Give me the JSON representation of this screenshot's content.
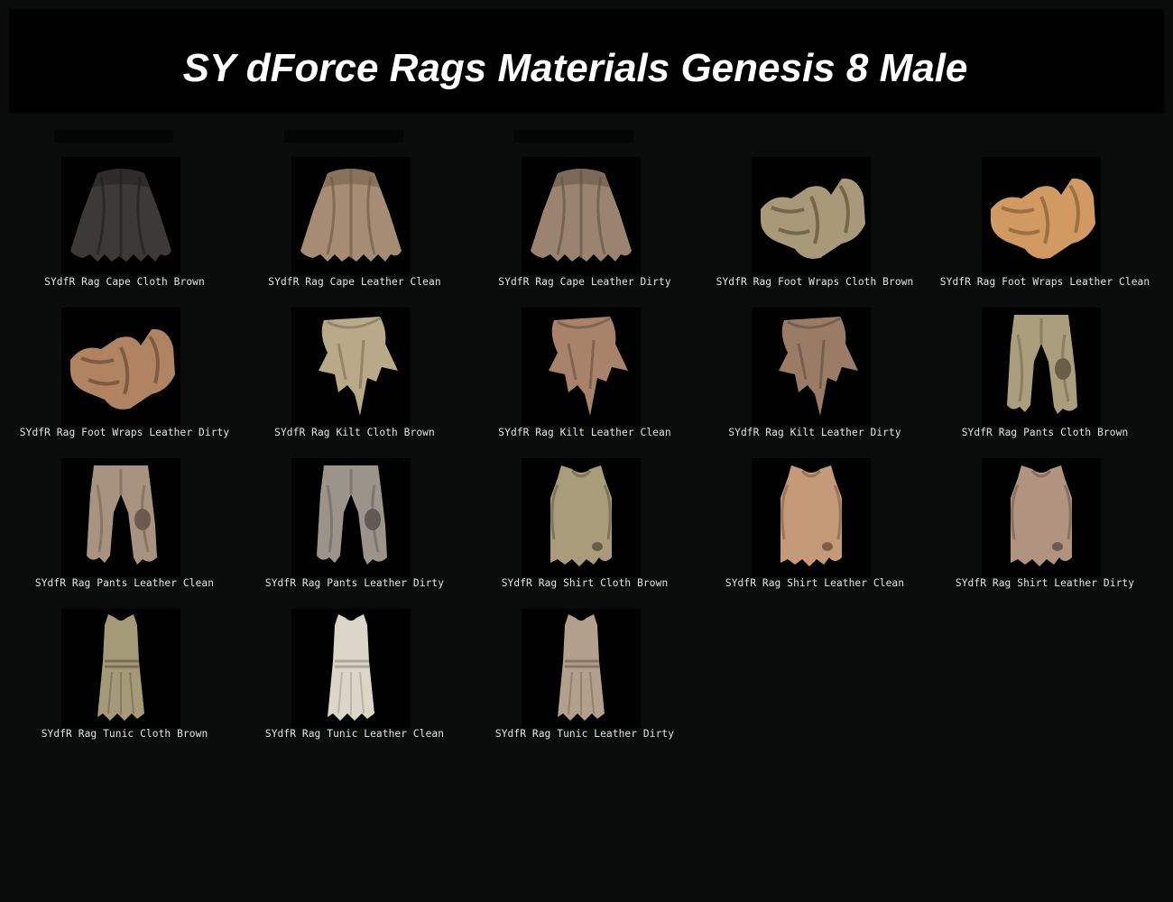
{
  "page": {
    "title": "SY dForce Rags Materials Genesis 8 Male"
  },
  "items": [
    {
      "label": "SYdfR Rag Cape Cloth Brown",
      "type": "cape",
      "color": "#3b3a38",
      "shade": "#1f1e1d"
    },
    {
      "label": "SYdfR Rag Cape Leather Clean",
      "type": "cape",
      "color": "#a58c72",
      "shade": "#6b5744"
    },
    {
      "label": "SYdfR Rag Cape Leather Dirty",
      "type": "cape",
      "color": "#9a8470",
      "shade": "#5f4e40"
    },
    {
      "label": "SYdfR Rag Foot Wraps Cloth Brown",
      "type": "foot",
      "color": "#a89a78",
      "shade": "#5e5238"
    },
    {
      "label": "SYdfR Rag Foot Wraps Leather Clean",
      "type": "foot",
      "color": "#d09a62",
      "shade": "#8a5c32"
    },
    {
      "label": "SYdfR Rag Foot Wraps Leather Dirty",
      "type": "foot",
      "color": "#b08462",
      "shade": "#6a4a33"
    },
    {
      "label": "SYdfR Rag Kilt Cloth Brown",
      "type": "kilt",
      "color": "#b8aa88",
      "shade": "#7a6c50"
    },
    {
      "label": "SYdfR Rag Kilt Leather Clean",
      "type": "kilt",
      "color": "#a8836a",
      "shade": "#6c4f3c"
    },
    {
      "label": "SYdfR Rag Kilt Leather Dirty",
      "type": "kilt",
      "color": "#9a7c66",
      "shade": "#604c3e"
    },
    {
      "label": "SYdfR Rag Pants Cloth Brown",
      "type": "pants",
      "color": "#aa9e7c",
      "shade": "#6a5f46"
    },
    {
      "label": "SYdfR Rag Pants Leather Clean",
      "type": "pants",
      "color": "#a89280",
      "shade": "#6c5a4c"
    },
    {
      "label": "SYdfR Rag Pants Leather Dirty",
      "type": "pants",
      "color": "#9c948a",
      "shade": "#625a52"
    },
    {
      "label": "SYdfR Rag Shirt Cloth Brown",
      "type": "shirt",
      "color": "#a89c7a",
      "shade": "#685d44"
    },
    {
      "label": "SYdfR Rag Shirt Leather Clean",
      "type": "shirt",
      "color": "#c49a78",
      "shade": "#805e44"
    },
    {
      "label": "SYdfR Rag Shirt Leather Dirty",
      "type": "shirt",
      "color": "#b09480",
      "shade": "#6e5a4c"
    },
    {
      "label": "SYdfR Rag Tunic Cloth Brown",
      "type": "tunic",
      "color": "#a49a78",
      "shade": "#645c44"
    },
    {
      "label": "SYdfR Rag Tunic Leather Clean",
      "type": "tunic",
      "color": "#dcd6c8",
      "shade": "#9a9484"
    },
    {
      "label": "SYdfR Rag Tunic Leather Dirty",
      "type": "tunic",
      "color": "#b2a08c",
      "shade": "#726252"
    }
  ]
}
